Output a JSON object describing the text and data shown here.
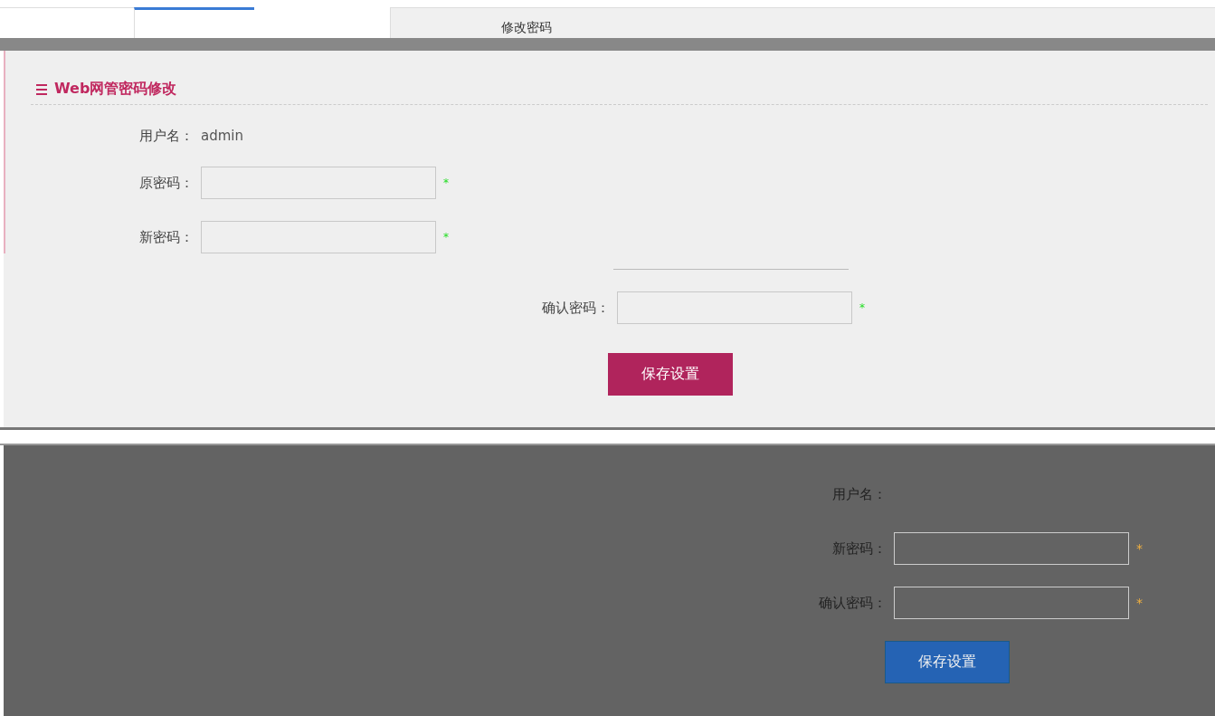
{
  "tabs": [
    {
      "selected": true
    },
    {
      "label": "修改密码",
      "selected": false
    }
  ],
  "upper_panel": {
    "title": "Web网管密码修改",
    "username_label": "用户名：",
    "username": "admin",
    "fields": [
      {
        "label": "原密码：",
        "required": "*"
      },
      {
        "label": "新密码：",
        "required": "*"
      }
    ]
  },
  "middle_panel": {
    "fields": [
      {
        "label": "确认密码：",
        "required": "*"
      }
    ],
    "button": "保存设置"
  },
  "lower_panel": {
    "username_label": "用户名：",
    "fields": [
      {
        "label": "新密码：",
        "required": "*"
      },
      {
        "label": "确认密码：",
        "required": "*"
      }
    ],
    "button": "保存设置"
  }
}
